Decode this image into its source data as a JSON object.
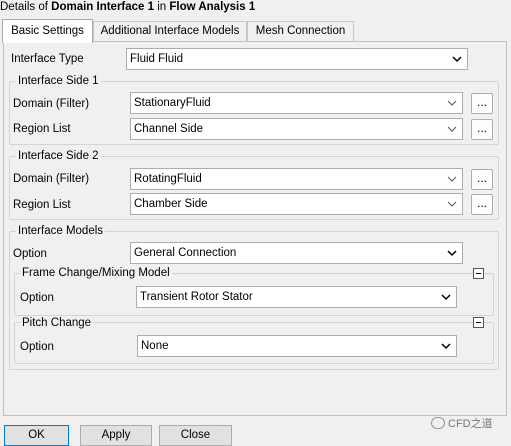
{
  "window": {
    "title_prefix": "Details of ",
    "object_name": "Domain Interface 1",
    "title_mid": " in ",
    "parent_name": "Flow Analysis 1"
  },
  "tabs": [
    {
      "label": "Basic Settings",
      "active": true
    },
    {
      "label": "Additional Interface Models",
      "active": false
    },
    {
      "label": "Mesh Connection",
      "active": false
    }
  ],
  "interface_type": {
    "label": "Interface Type",
    "value": "Fluid Fluid"
  },
  "side1": {
    "title": "Interface Side 1",
    "domain_label": "Domain (Filter)",
    "domain_value": "StationaryFluid",
    "region_label": "Region List",
    "region_value": "Channel Side",
    "browse": "..."
  },
  "side2": {
    "title": "Interface Side 2",
    "domain_label": "Domain (Filter)",
    "domain_value": "RotatingFluid",
    "region_label": "Region List",
    "region_value": "Chamber Side",
    "browse": "..."
  },
  "models": {
    "title": "Interface Models",
    "option_label": "Option",
    "option_value": "General Connection",
    "frame_change": {
      "title": "Frame Change/Mixing Model",
      "option_label": "Option",
      "option_value": "Transient Rotor Stator"
    },
    "pitch_change": {
      "title": "Pitch Change",
      "option_label": "Option",
      "option_value": "None"
    }
  },
  "buttons": {
    "ok": "OK",
    "apply": "Apply",
    "close": "Close"
  },
  "watermark": "CFD之道"
}
